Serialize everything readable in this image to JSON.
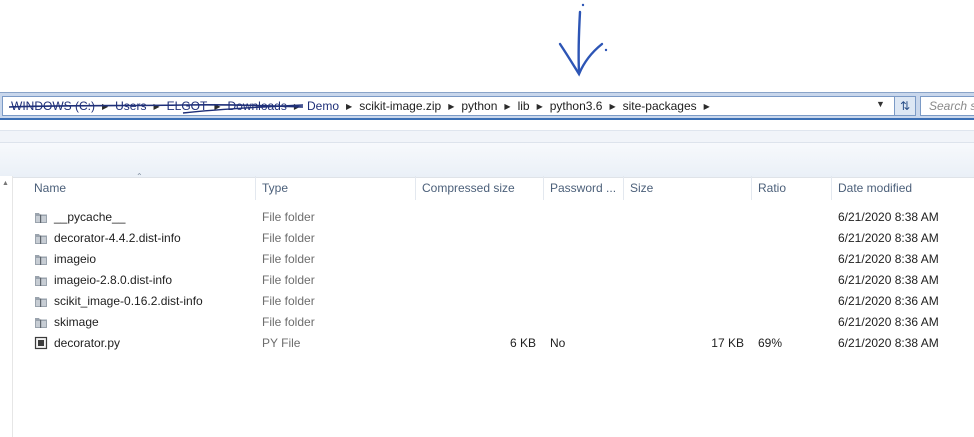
{
  "breadcrumb": {
    "items": [
      "WINDOWS (C:)",
      "Users",
      "ELGOT",
      "Downloads",
      "Demo",
      "scikit-image.zip",
      "python",
      "lib",
      "python3.6",
      "site-packages"
    ]
  },
  "search": {
    "placeholder": "Search s"
  },
  "columns": {
    "name": "Name",
    "type": "Type",
    "compressed_size": "Compressed size",
    "password": "Password ...",
    "size": "Size",
    "ratio": "Ratio",
    "date_modified": "Date modified"
  },
  "files": [
    {
      "name": "__pycache__",
      "type": "File folder",
      "compressed": "",
      "password": "",
      "size": "",
      "ratio": "",
      "date": "6/21/2020 8:38 AM",
      "icon": "folder-icon"
    },
    {
      "name": "decorator-4.4.2.dist-info",
      "type": "File folder",
      "compressed": "",
      "password": "",
      "size": "",
      "ratio": "",
      "date": "6/21/2020 8:38 AM",
      "icon": "folder-icon"
    },
    {
      "name": "imageio",
      "type": "File folder",
      "compressed": "",
      "password": "",
      "size": "",
      "ratio": "",
      "date": "6/21/2020 8:38 AM",
      "icon": "folder-icon"
    },
    {
      "name": "imageio-2.8.0.dist-info",
      "type": "File folder",
      "compressed": "",
      "password": "",
      "size": "",
      "ratio": "",
      "date": "6/21/2020 8:38 AM",
      "icon": "folder-icon"
    },
    {
      "name": "scikit_image-0.16.2.dist-info",
      "type": "File folder",
      "compressed": "",
      "password": "",
      "size": "",
      "ratio": "",
      "date": "6/21/2020 8:36 AM",
      "icon": "folder-icon"
    },
    {
      "name": "skimage",
      "type": "File folder",
      "compressed": "",
      "password": "",
      "size": "",
      "ratio": "",
      "date": "6/21/2020 8:36 AM",
      "icon": "folder-icon"
    },
    {
      "name": "decorator.py",
      "type": "PY File",
      "compressed": "6 KB",
      "password": "No",
      "size": "17 KB",
      "ratio": "69%",
      "date": "6/21/2020 8:38 AM",
      "icon": "python-file-icon"
    }
  ],
  "colors": {
    "annotation": "#2d55b5",
    "address_bar": "#c9d7ec",
    "header_text": "#4c607a"
  }
}
